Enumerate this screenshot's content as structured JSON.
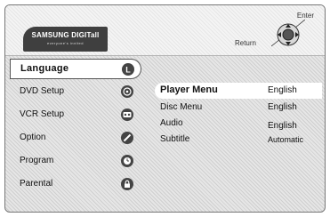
{
  "header": {
    "brand": "SAMSUNG DIGITall",
    "brand_tagline": "everyone's invited",
    "nav_enter": "Enter",
    "nav_return": "Return"
  },
  "menu": {
    "items": [
      {
        "label": "Language",
        "icon": "language-icon",
        "active": true
      },
      {
        "label": "DVD Setup",
        "icon": "disc-icon"
      },
      {
        "label": "VCR Setup",
        "icon": "cassette-icon"
      },
      {
        "label": "Option",
        "icon": "option-icon"
      },
      {
        "label": "Program",
        "icon": "program-icon"
      },
      {
        "label": "Parental",
        "icon": "lock-icon"
      }
    ]
  },
  "language": {
    "rows": [
      {
        "name": "Player Menu",
        "value": "English",
        "active": true
      },
      {
        "name": "Disc Menu",
        "value": "English"
      },
      {
        "name": "Audio",
        "value": "English"
      },
      {
        "name": "Subtitle",
        "value": "Automatic"
      }
    ]
  }
}
